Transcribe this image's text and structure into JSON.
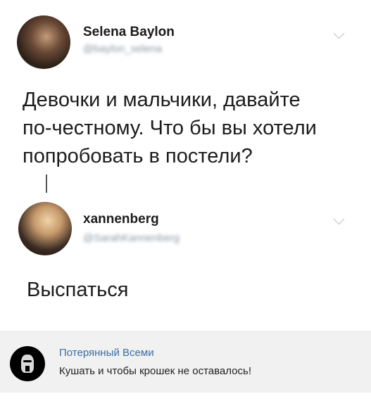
{
  "tweet1": {
    "name": "Selena Baylon",
    "handle": "@baylon_selena",
    "text": "Девочки и мальчики, давайте\nпо-честному. Что бы вы хотели\nпопробовать в постели?"
  },
  "tweet2": {
    "name": "xannenberg",
    "handle": "@SarahKannenberg",
    "text": "Выспаться"
  },
  "comment": {
    "name": "Потерянный Всеми",
    "text": "Кушать и чтобы крошек не оставалось!"
  },
  "icons": {
    "tweet_menu": "chevron-down-icon",
    "thread": "thread-line"
  },
  "colors": {
    "handle": "#8b98a5",
    "comment_name": "#3a6ea5",
    "comment_bg": "#f1f1f1"
  }
}
